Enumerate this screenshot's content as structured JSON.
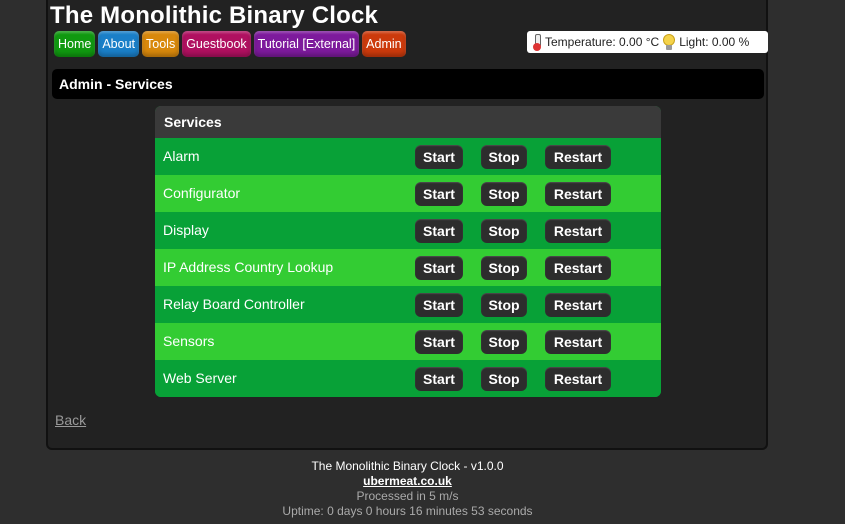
{
  "app": {
    "title": "The Monolithic Binary Clock"
  },
  "nav": [
    {
      "label": "Home",
      "color": "#109910"
    },
    {
      "label": "About",
      "color": "#1a7fc8"
    },
    {
      "label": "Tools",
      "color": "#d8880c"
    },
    {
      "label": "Guestbook",
      "color": "#b01060"
    },
    {
      "label": "Tutorial [External]",
      "color": "#7d1a9c"
    },
    {
      "label": "Admin",
      "color": "#cc3a0c"
    }
  ],
  "sensors": {
    "temperature_label": "Temperature: 0.00 °C",
    "light_label": "Light: 0.00 %"
  },
  "page": {
    "heading": "Admin - Services"
  },
  "services_panel": {
    "heading": "Services",
    "start_label": "Start",
    "stop_label": "Stop",
    "restart_label": "Restart",
    "rows": [
      {
        "name": "Alarm"
      },
      {
        "name": "Configurator"
      },
      {
        "name": "Display"
      },
      {
        "name": "IP Address Country Lookup"
      },
      {
        "name": "Relay Board Controller"
      },
      {
        "name": "Sensors"
      },
      {
        "name": "Web Server"
      }
    ]
  },
  "back_link": "Back",
  "footer": {
    "version": "The Monolithic Binary Clock - v1.0.0",
    "site": "ubermeat.co.uk",
    "processed": "Processed in 5 m/s",
    "uptime": "Uptime: 0 days 0 hours 16 minutes 53 seconds"
  },
  "colors": {
    "row_dark": "#08a137",
    "row_light": "#33cc33",
    "button_bg": "#2d2d2d"
  }
}
